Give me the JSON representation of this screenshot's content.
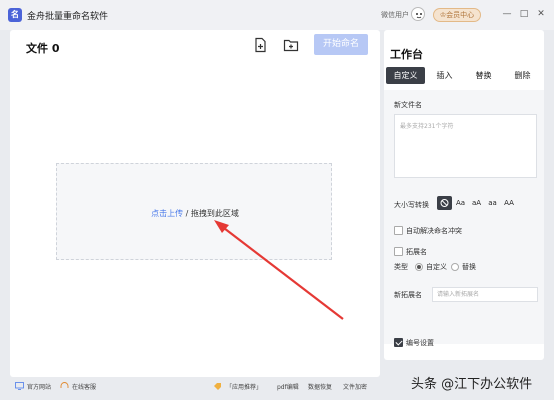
{
  "titlebar": {
    "logo_text": "名",
    "app_title": "金舟批量重命名软件",
    "wx_user": "微信用户",
    "vip_label": "会员中心",
    "controls": [
      "—",
      "□",
      "✕"
    ]
  },
  "left": {
    "file_count": "文件 0",
    "start_button": "开始命名",
    "drop_link": "点击上传",
    "drop_rest": " / 拖拽到此区域"
  },
  "right": {
    "title": "工作台",
    "tabs": [
      "自定义",
      "插入",
      "替换",
      "删除"
    ],
    "active_tab": "自定义",
    "new_name_label": "新文件名",
    "new_name_placeholder": "最多支持231个字符",
    "case_label": "大小写转换",
    "case_options": [
      "Aa",
      "aA",
      "aa",
      "AA"
    ],
    "auto_resolve_label": "自动解决命名冲突",
    "ext_label": "拓展名",
    "type_label": "类型",
    "type_options": [
      "自定义",
      "替换"
    ],
    "new_ext_label": "新拓展名",
    "new_ext_placeholder": "请输入新拓展名",
    "numbering_label": "编号设置"
  },
  "footer": {
    "website": "官方网站",
    "support": "在线客服",
    "apps": "「应用推荐」",
    "pdf_edit": "pdf编辑",
    "data_recovery": "数据恢复",
    "file_encrypt": "文件加密"
  },
  "watermark": "头条 @江下办公软件",
  "colors": {
    "accent": "#4b7bea",
    "start_button": "#b7c8f5",
    "dark_tab": "#3b3f47",
    "arrow": "#e53935"
  }
}
